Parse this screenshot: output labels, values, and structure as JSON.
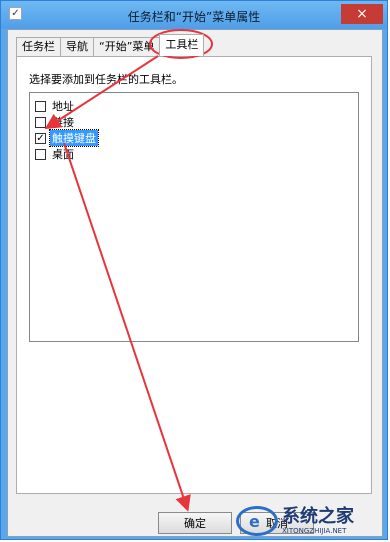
{
  "window": {
    "title": "任务栏和“开始”菜单属性",
    "close_glyph": "×"
  },
  "tabs": [
    {
      "label": "任务栏",
      "active": false
    },
    {
      "label": "导航",
      "active": false
    },
    {
      "label": "“开始”菜单",
      "active": false
    },
    {
      "label": "工具栏",
      "active": true
    }
  ],
  "panel": {
    "description": "选择要添加到任务栏的工具栏。",
    "items": [
      {
        "label": "地址",
        "checked": false,
        "selected": false
      },
      {
        "label": "链接",
        "checked": false,
        "selected": false
      },
      {
        "label": "触摸键盘",
        "checked": true,
        "selected": true
      },
      {
        "label": "桌面",
        "checked": false,
        "selected": false
      }
    ]
  },
  "buttons": {
    "ok": "确定",
    "cancel": "取消"
  },
  "watermark": {
    "title": "系统之家",
    "subtitle": "XITONGZHIJIA.NET"
  },
  "colors": {
    "annotation": "#e8343c",
    "selection": "#3399ff",
    "titlebar": "#5aa7ec"
  }
}
